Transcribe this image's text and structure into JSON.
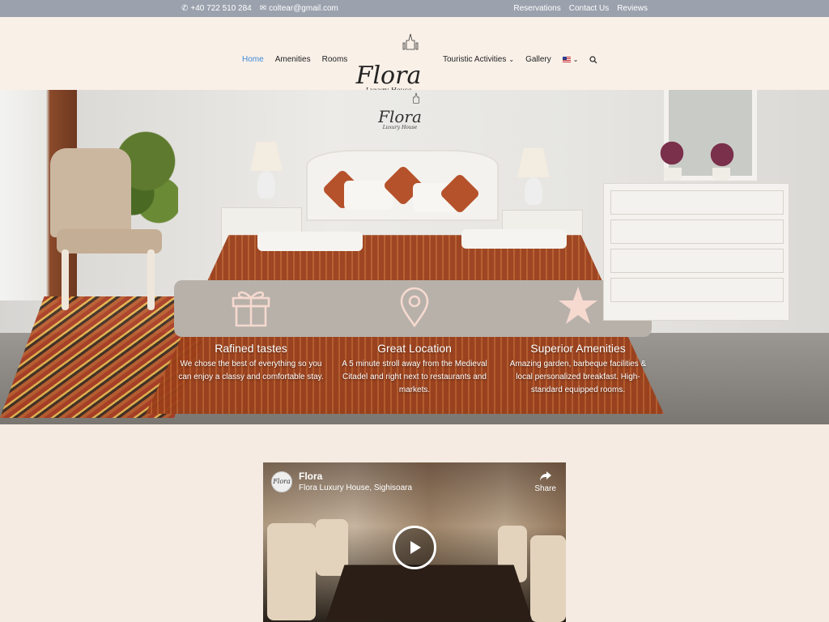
{
  "topbar": {
    "phone": "+40 722 510 284",
    "email": "coltear@gmail.com",
    "links": [
      "Reservations",
      "Contact Us",
      "Reviews"
    ]
  },
  "nav": {
    "left": [
      "Home",
      "Amenities",
      "Rooms"
    ],
    "right": [
      "Touristic Activities",
      "Gallery"
    ],
    "active": "Home"
  },
  "logo": {
    "name": "Flora",
    "tagline": "Luxury House"
  },
  "features": [
    {
      "icon": "gift-icon",
      "title": "Rafined tastes",
      "desc": "We chose the best of everything so you can enjoy a classy and comfortable stay."
    },
    {
      "icon": "location-pin-icon",
      "title": "Great Location",
      "desc": "A 5 minute stroll away from the Medieval Citadel and right next to restaurants and markets."
    },
    {
      "icon": "star-icon",
      "title": "Superior Amenities",
      "desc": "Amazing garden, barbeque facilities & local personalized breakfast. High-standard equipped rooms."
    }
  ],
  "video": {
    "title": "Flora",
    "subtitle": "Flora Luxury House, Sighisoara",
    "share": "Share"
  },
  "colors": {
    "topbar_bg": "#9ba1ad",
    "page_bg": "#f5ebe2",
    "nav_active": "#3d8bd6",
    "feature_icon": "#f6d9cf"
  }
}
